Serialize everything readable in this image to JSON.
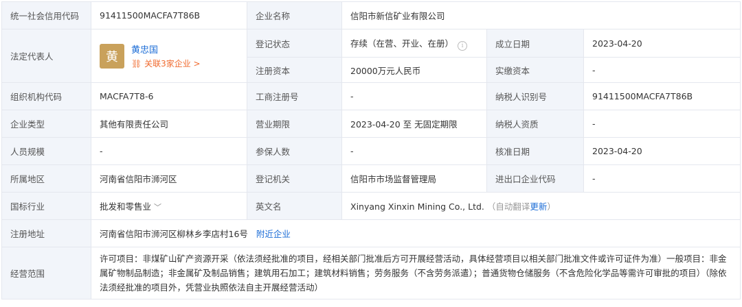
{
  "labels": {
    "credit_code": "统一社会信用代码",
    "company_name": "企业名称",
    "legal_rep": "法定代表人",
    "reg_status": "登记状态",
    "established": "成立日期",
    "reg_capital": "注册资本",
    "paid_capital": "实缴资本",
    "org_code": "组织机构代码",
    "biz_reg_no": "工商注册号",
    "taxpayer_id": "纳税人识别号",
    "company_type": "企业类型",
    "biz_term": "营业期限",
    "taxpayer_qual": "纳税人资质",
    "staff_size": "人员规模",
    "insured": "参保人数",
    "approved_date": "核准日期",
    "region": "所属地区",
    "reg_authority": "登记机关",
    "ie_code": "进出口企业代码",
    "industry": "国标行业",
    "english_name": "英文名",
    "reg_address": "注册地址",
    "scope": "经营范围"
  },
  "values": {
    "credit_code": "91411500MACFA7T86B",
    "company_name": "信阳市新信矿业有限公司",
    "legal_rep_avatar": "黄",
    "legal_rep_name": "黄忠国",
    "legal_rep_assoc": "关联3家企业 >",
    "reg_status": "存续（在营、开业、在册）",
    "established": "2023-04-20",
    "reg_capital": "20000万元人民币",
    "paid_capital": "-",
    "org_code": "MACFA7T8-6",
    "biz_reg_no": "-",
    "taxpayer_id": "91411500MACFA7T86B",
    "company_type": "其他有限责任公司",
    "biz_term": "2023-04-20 至 无固定期限",
    "taxpayer_qual": "-",
    "staff_size": "-",
    "insured": "-",
    "approved_date": "2023-04-20",
    "region": "河南省信阳市浉河区",
    "reg_authority": "信阳市市场监督管理局",
    "ie_code": "-",
    "industry": "批发和零售业",
    "english_name": "Xinyang Xinxin Mining Co., Ltd.",
    "auto_translate": "（自动翻译",
    "update_link": "更新",
    "auto_translate_close": "）",
    "reg_address": "河南省信阳市浉河区柳林乡李店村16号",
    "nearby_link": "附近企业",
    "scope": "许可项目：非煤矿山矿产资源开采（依法须经批准的项目，经相关部门批准后方可开展经营活动，具体经营项目以相关部门批准文件或许可证件为准）一般项目：非金属矿物制品制造；非金属矿及制品销售；建筑用石加工；建筑材料销售；劳务服务（不含劳务派遣）；普通货物仓储服务（不含危险化学品等需许可审批的项目）（除依法须经批准的项目外，凭营业执照依法自主开展经营活动）"
  },
  "icons": {
    "info": "info-circle-icon",
    "chevron": "chevron-down-icon",
    "relation": "relation-icon"
  },
  "colors": {
    "label_bg": "#f2f5fa",
    "link": "#1b6cd6",
    "assoc": "#f06a2e",
    "avatar": "#c9a15b"
  }
}
